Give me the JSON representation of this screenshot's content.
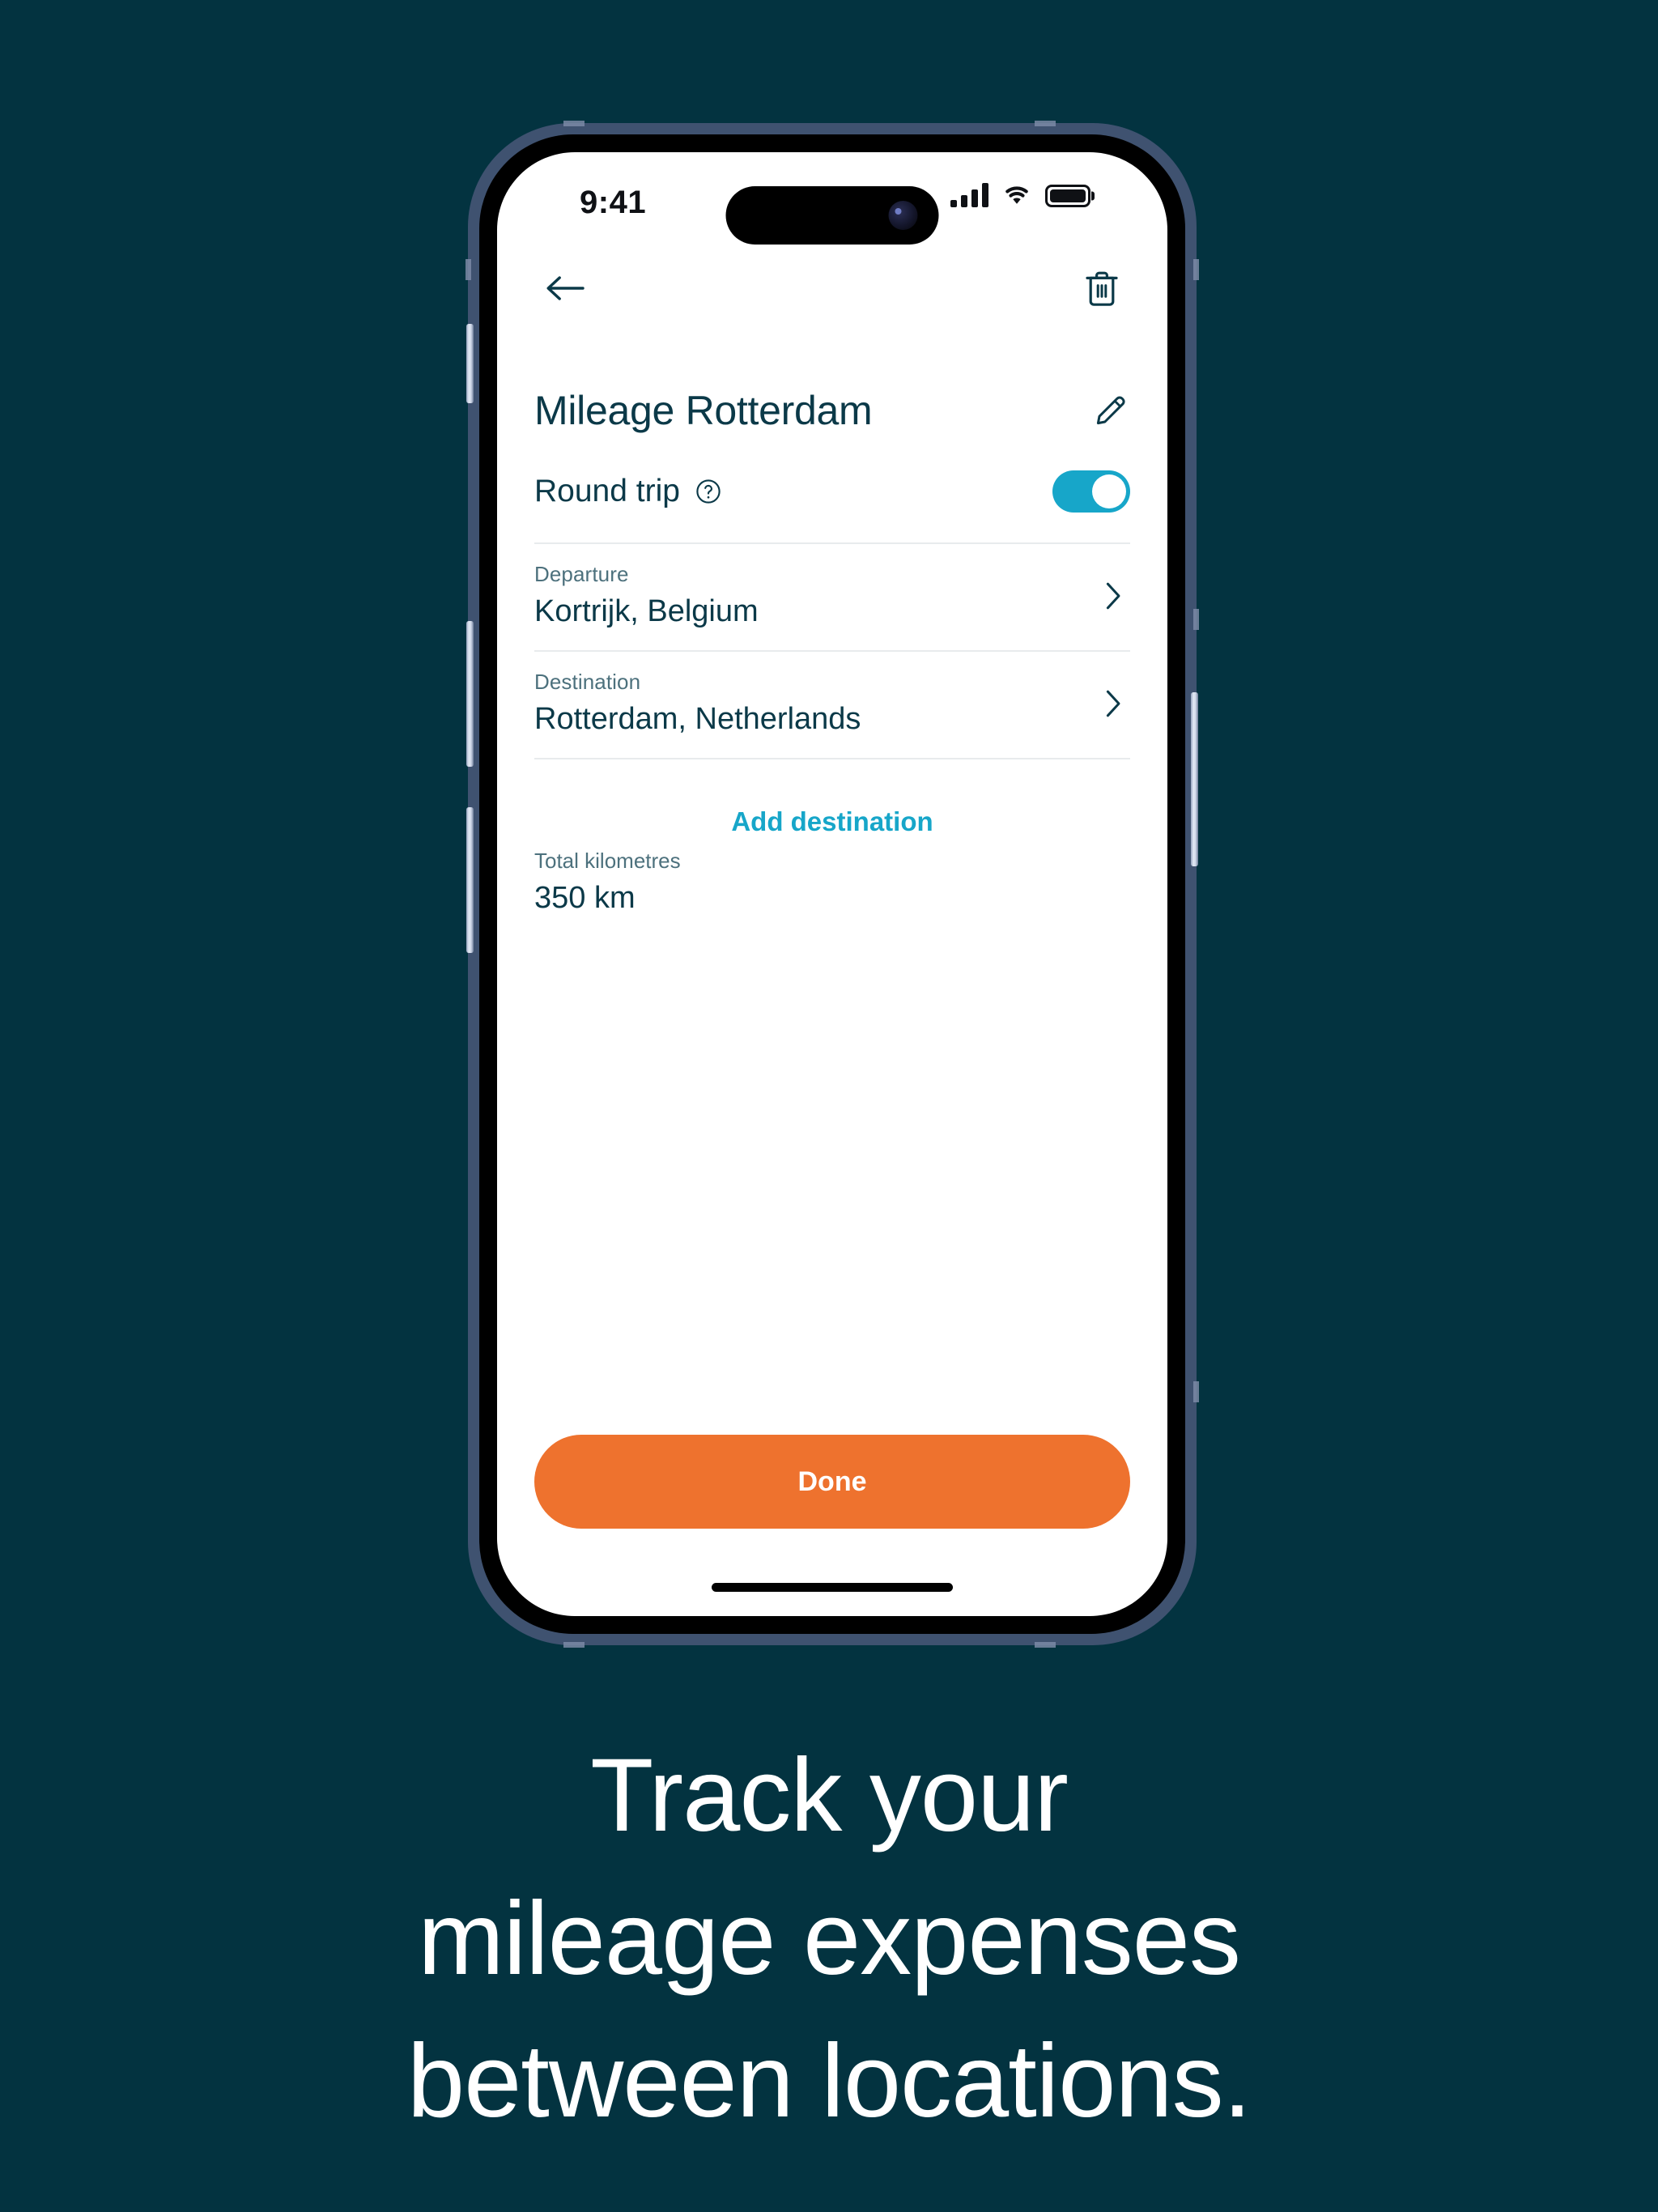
{
  "theme": {
    "background": "#033340",
    "accent_cyan": "#17a6c9",
    "accent_orange": "#ee722e",
    "text_dark": "#0b3948",
    "text_muted": "#4d717d",
    "frame_band": "#3f5270"
  },
  "status_bar": {
    "time": "9:41",
    "signal_icon": "cellular-signal-icon",
    "wifi_icon": "wifi-icon",
    "battery_icon": "battery-full-icon"
  },
  "nav_bar": {
    "back_icon": "arrow-left-icon",
    "delete_icon": "trash-icon"
  },
  "header": {
    "title": "Mileage Rotterdam",
    "edit_icon": "pencil-icon"
  },
  "round_trip": {
    "label": "Round trip",
    "help_icon": "question-circle-icon",
    "toggle_state": "on"
  },
  "fields": [
    {
      "label": "Departure",
      "value": "Kortrijk, Belgium",
      "chevron_icon": "chevron-right-icon"
    },
    {
      "label": "Destination",
      "value": "Rotterdam, Netherlands",
      "chevron_icon": "chevron-right-icon"
    }
  ],
  "add_destination": {
    "label": "Add destination"
  },
  "total": {
    "label": "Total kilometres",
    "value": "350 km"
  },
  "primary_action": {
    "label": "Done"
  },
  "caption": {
    "line1": "Track your",
    "line2": "mileage expenses",
    "line3": "between locations."
  }
}
